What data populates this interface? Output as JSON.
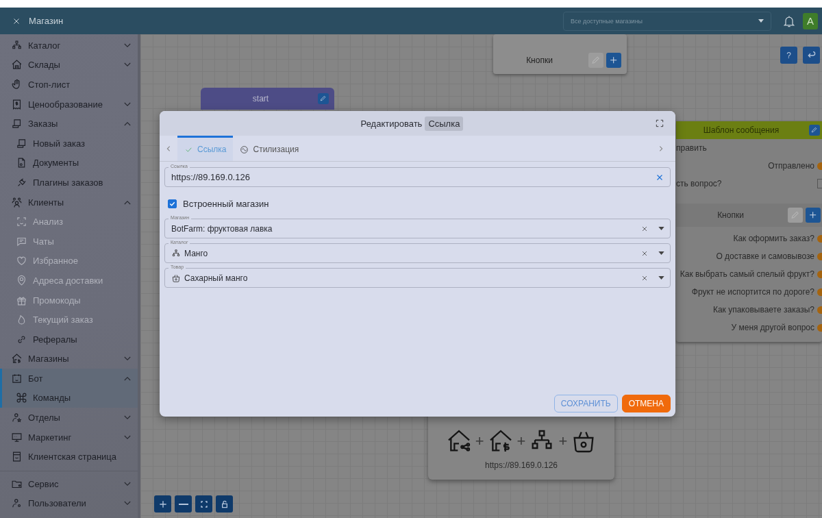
{
  "app_bar": {
    "title": "Магазин",
    "store_select": {
      "placeholder": "Все доступные магазины"
    },
    "avatar": "A"
  },
  "sidebar": {
    "sections": [
      {
        "items": [
          {
            "label": "Каталог",
            "kind": "group",
            "expanded": false,
            "selected": false,
            "disabled": false
          },
          {
            "label": "Склады",
            "kind": "group",
            "expanded": false,
            "selected": false,
            "disabled": false
          },
          {
            "label": "Стоп-лист",
            "kind": "link",
            "selected": false,
            "disabled": false
          },
          {
            "label": "Ценообразование",
            "kind": "group",
            "expanded": false,
            "selected": false,
            "disabled": false
          },
          {
            "label": "Заказы",
            "kind": "group",
            "expanded": true,
            "selected": false,
            "disabled": false,
            "children": [
              {
                "label": "Новый заказ",
                "disabled": false
              },
              {
                "label": "Документы",
                "disabled": false
              },
              {
                "label": "Плагины заказов",
                "disabled": false
              }
            ]
          },
          {
            "label": "Клиенты",
            "kind": "group",
            "expanded": true,
            "selected": false,
            "disabled": false,
            "children": [
              {
                "label": "Анализ",
                "disabled": true
              },
              {
                "label": "Чаты",
                "disabled": true
              },
              {
                "label": "Избранное",
                "disabled": true
              },
              {
                "label": "Адреса доставки",
                "disabled": true
              },
              {
                "label": "Промокоды",
                "disabled": true
              },
              {
                "label": "Текущий заказ",
                "disabled": true
              },
              {
                "label": "Рефералы",
                "disabled": false
              }
            ]
          },
          {
            "label": "Магазины",
            "kind": "group",
            "expanded": false,
            "selected": false,
            "disabled": false
          },
          {
            "label": "Бот",
            "kind": "group",
            "expanded": true,
            "selected": true,
            "disabled": false,
            "children": [
              {
                "label": "Команды",
                "disabled": false
              }
            ]
          },
          {
            "label": "Отделы",
            "kind": "group",
            "expanded": false,
            "selected": false,
            "disabled": false
          },
          {
            "label": "Маркетинг",
            "kind": "group",
            "expanded": false,
            "selected": false,
            "disabled": false
          },
          {
            "label": "Клиентская страница",
            "kind": "link",
            "selected": false,
            "disabled": false
          }
        ]
      },
      {
        "items": [
          {
            "label": "Сервис",
            "kind": "group",
            "expanded": false,
            "selected": false,
            "disabled": false
          },
          {
            "label": "Пользователи",
            "kind": "group",
            "expanded": false,
            "selected": false,
            "disabled": false
          }
        ]
      }
    ]
  },
  "canvas": {
    "help_button": "?",
    "buttons_node": {
      "title": "Кнопки"
    },
    "start_node": {
      "title": "start"
    },
    "message_node": {
      "title": "Шаблон сообщения",
      "rows": [
        {
          "kind": "action",
          "text": "править"
        },
        {
          "kind": "output",
          "text": "Отправлено"
        },
        {
          "kind": "question",
          "text": "сть вопрос?",
          "checked": false
        }
      ],
      "buttons_section": {
        "title": "Кнопки",
        "items": [
          "Как оформить заказ?",
          "О доставке и самовывозе",
          "Как выбрать самый спелый фрукт?",
          "Фрукт не испортится по дороге?",
          "Как упаковываете заказы?",
          "У меня другой вопрос"
        ]
      }
    },
    "link_node": {
      "separator": "+",
      "url": "https://89.169.0.126"
    }
  },
  "dialog": {
    "title": "Редактировать",
    "title_chip": "Ссылка",
    "tabs": [
      {
        "label": "Ссылка",
        "selected": true
      },
      {
        "label": "Стилизация",
        "selected": false
      }
    ],
    "url_field": {
      "label": "Ссылка",
      "value": "https://89.169.0.126"
    },
    "embedded_store": {
      "label": "Встроенный магазин",
      "checked": true
    },
    "selects": [
      {
        "label": "Магазин",
        "value": "BotFarm: фруктовая лавка"
      },
      {
        "label": "Каталог",
        "value": "Манго"
      },
      {
        "label": "Товар",
        "value": "Сахарный манго"
      }
    ],
    "buttons": [
      {
        "kind": "save",
        "label": "СОХРАНИТЬ"
      },
      {
        "kind": "cancel",
        "label": "ОТМЕНА"
      }
    ]
  }
}
